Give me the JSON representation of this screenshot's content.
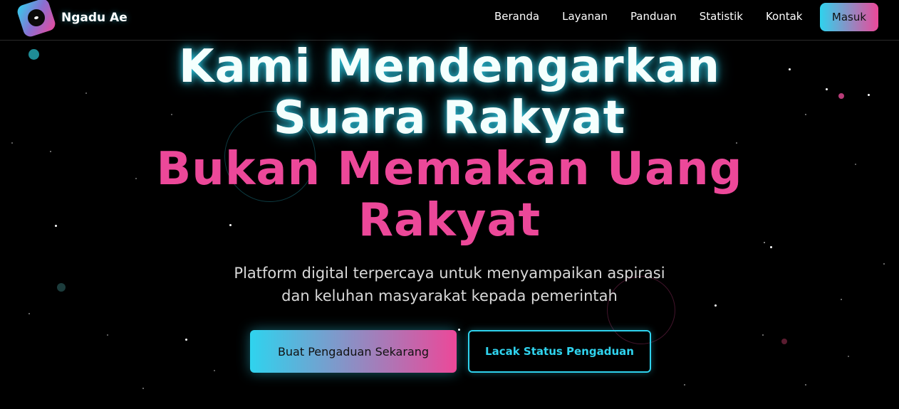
{
  "brand": {
    "name": "Ngadu Ae",
    "logo_icon": "megaphone-logo-icon"
  },
  "nav": {
    "items": [
      "Beranda",
      "Layanan",
      "Panduan",
      "Statistik",
      "Kontak"
    ],
    "login_label": "Masuk"
  },
  "hero": {
    "title_line1": "Kami Mendengarkan",
    "title_line2": "Suara Rakyat",
    "title_line3": "Bukan Memakan Uang",
    "title_line4": "Rakyat",
    "subtitle_line1": "Platform digital terpercaya untuk menyampaikan aspirasi",
    "subtitle_line2": "dan keluhan masyarakat kepada pemerintah",
    "primary_cta": "Buat Pengaduan Sekarang",
    "secondary_cta": "Lacak Status Pengaduan"
  },
  "colors": {
    "background": "#000000",
    "accent_cyan": "#2fd3ee",
    "accent_pink": "#ec4899",
    "text_white": "#ffffff"
  }
}
